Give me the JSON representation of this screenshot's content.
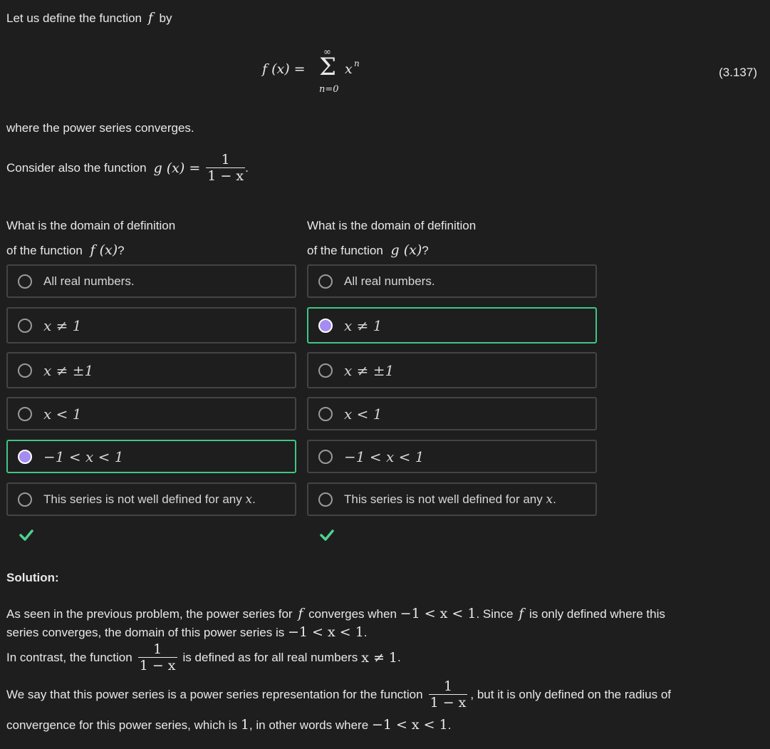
{
  "intro": {
    "text1": "Let us define the function",
    "f": "f",
    "text2": "by"
  },
  "equation": {
    "lhs": "f (x) =",
    "sum_top": "∞",
    "sum_sign": "Σ",
    "sum_bottom": "n=0",
    "term": "x",
    "term_sup": "n",
    "number": "(3.137)"
  },
  "converges_text": "where the power series converges.",
  "consider": {
    "text": "Consider also the function",
    "lhs": "g (x) =",
    "num": "1",
    "den": "1 − x",
    "period": "."
  },
  "question_f": {
    "line1": "What is the domain of definition",
    "line2_text": "of the function",
    "line2_math": "f (x)",
    "line2_end": "?"
  },
  "question_g": {
    "line1": "What is the domain of definition",
    "line2_text": "of the function",
    "line2_math": "g (x)",
    "line2_end": "?"
  },
  "options": {
    "o1": "All real numbers.",
    "o2": "x ≠ 1",
    "o3": "x ≠ ±1",
    "o4": "x < 1",
    "o5": "−1 < x < 1",
    "o6_text": "This series is not well defined for any",
    "o6_math": "x",
    "o6_end": "."
  },
  "selected": {
    "f_option": "−1 < x < 1",
    "g_option": "x ≠ 1"
  },
  "colors": {
    "background": "#1e1e1e",
    "correct_border": "#3fc686",
    "radio_selected": "#a58cf0",
    "check": "#4fd08f"
  },
  "icons": {
    "correct": "check-icon"
  },
  "solution": {
    "heading": "Solution:",
    "p1a": "As seen in the previous problem, the power series for",
    "p1_f": "f",
    "p1b": "converges when",
    "p1_range": "−1 < x < 1",
    "p1c": ". Since",
    "p1_f2": "f",
    "p1d": "is only defined where this",
    "p2a": "series converges, the domain of this power series is",
    "p2_range": "−1 < x < 1",
    "p2b": ".",
    "p3a": "In contrast, the function",
    "p3_num": "1",
    "p3_den": "1 − x",
    "p3b": "is defined as for all real numbers",
    "p3_cond": "x ≠ 1",
    "p3c": ".",
    "p4a": "We say that this power series is a power series representation for the function",
    "p4_num": "1",
    "p4_den": "1 − x",
    "p4b": ", but it is only defined on the radius of",
    "p5a": "convergence for this power series, which is",
    "p5_one": "1",
    "p5b": ", in other words where",
    "p5_range": "−1 < x < 1",
    "p5c": "."
  }
}
